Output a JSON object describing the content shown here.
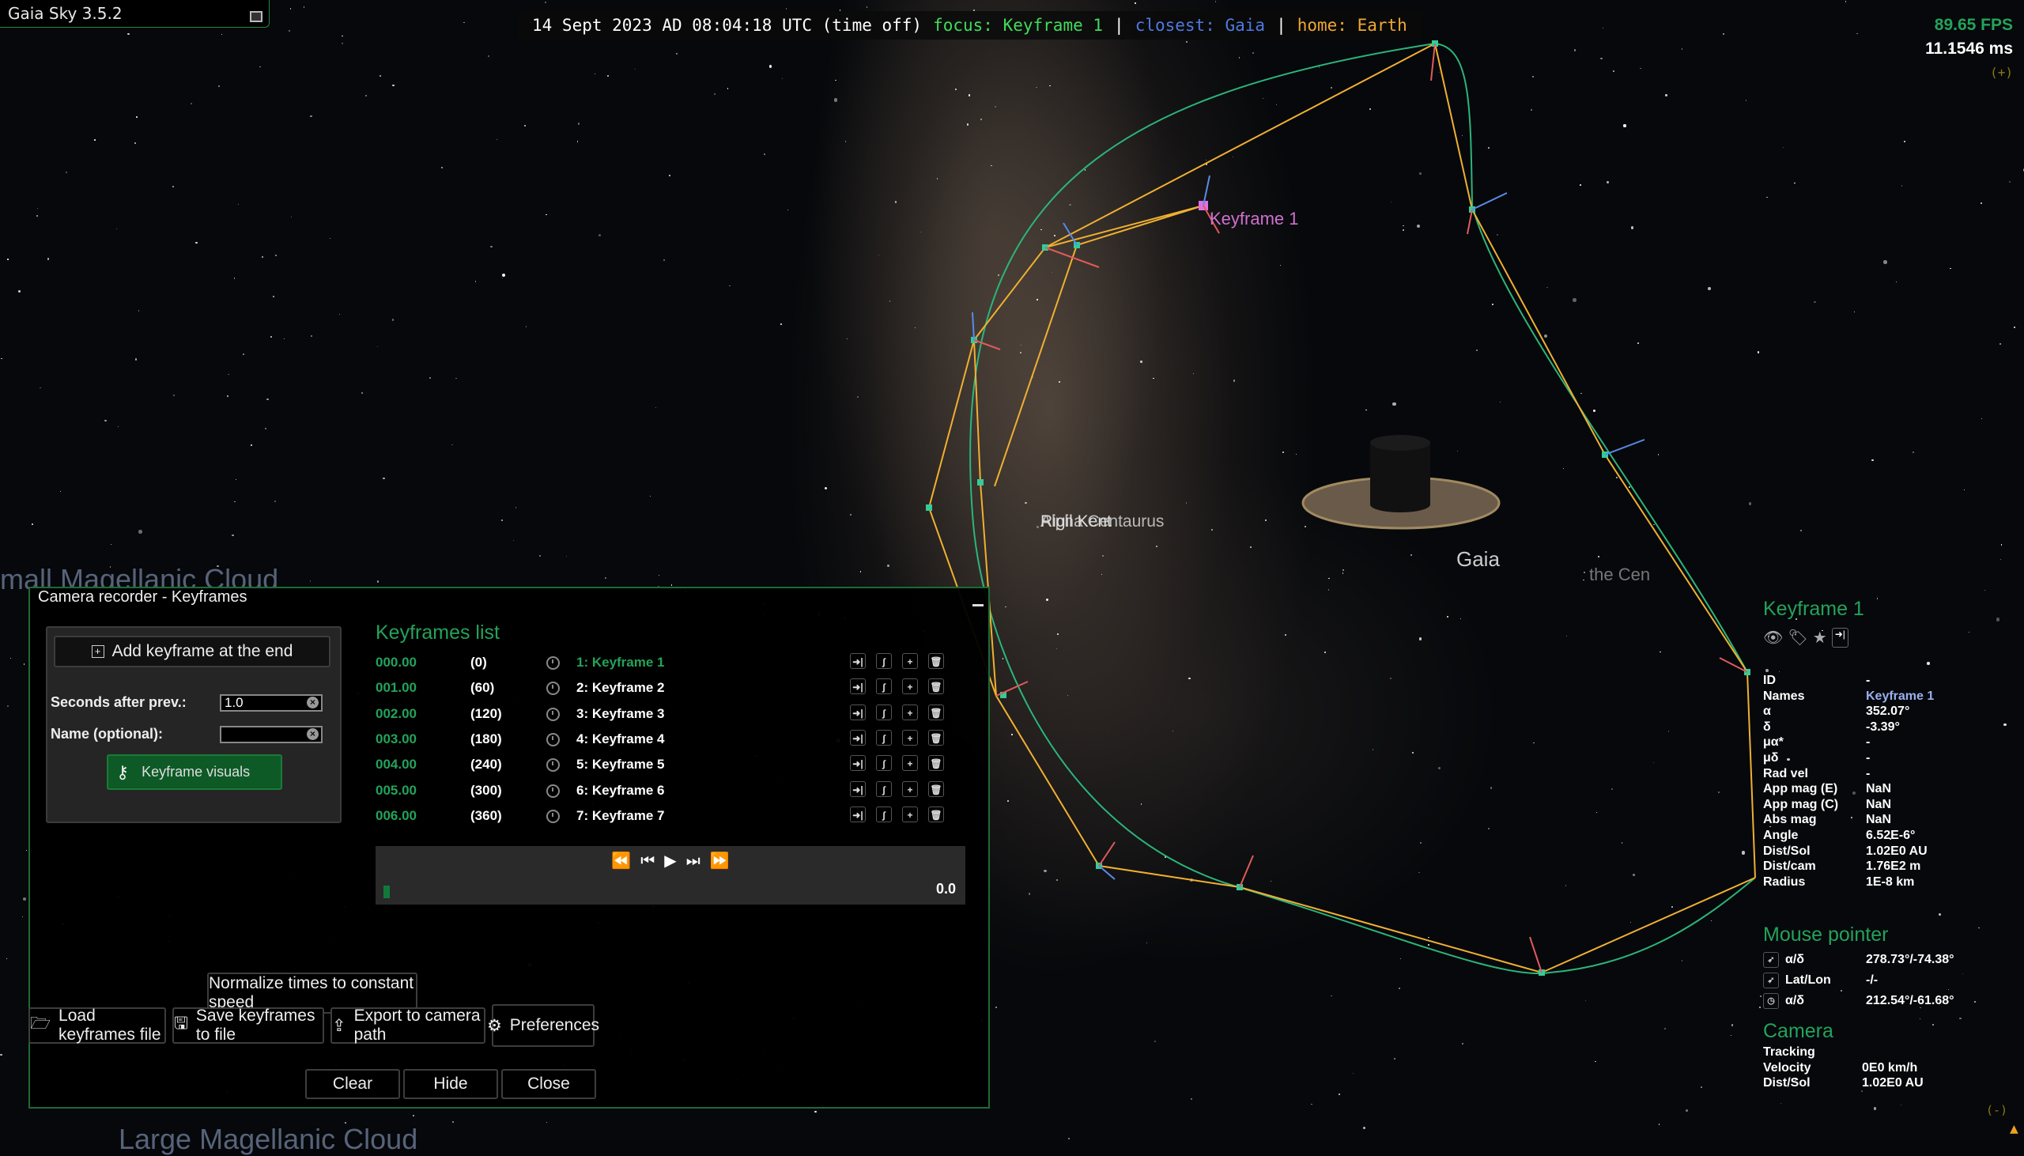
{
  "app": {
    "title": "Gaia Sky 3.5.2"
  },
  "topbar": {
    "datetime": "14 Sept 2023 AD 08:04:18 UTC (time off)",
    "focus": "focus: Keyframe 1",
    "closest": "closest: Gaia",
    "home": "home: Earth",
    "separator": "|",
    "colors": {
      "focus": "#3fdc5a",
      "closest": "#4f79e0",
      "home": "#f0a830"
    }
  },
  "perf": {
    "fps": "89.65 FPS",
    "frame_time": "11.1546 ms",
    "expand": "(+)"
  },
  "scene": {
    "labels": {
      "smc": "mall Magellanic Cloud",
      "lmc": "Large Magellanic Cloud",
      "overlap": "Rigil Kent",
      "centaurus": "Alpha Centaurus",
      "gaia": "Gaia",
      "the_cen": "the Cen",
      "keyframe": "Keyframe 1"
    }
  },
  "recorder": {
    "title": "Camera recorder - Keyframes",
    "add_button": "Add keyframe at the end",
    "seconds_label": "Seconds after prev.:",
    "seconds_value": "1.0",
    "name_label": "Name (optional):",
    "name_value": "",
    "visuals_button": "Keyframe visuals",
    "list_title": "Keyframes list",
    "keyframes": [
      {
        "time": "000.00",
        "frame": "(0)",
        "name": "1: Keyframe 1",
        "selected": true
      },
      {
        "time": "001.00",
        "frame": "(60)",
        "name": "2: Keyframe 2",
        "selected": false
      },
      {
        "time": "002.00",
        "frame": "(120)",
        "name": "3: Keyframe 3",
        "selected": false
      },
      {
        "time": "003.00",
        "frame": "(180)",
        "name": "4: Keyframe 4",
        "selected": false
      },
      {
        "time": "004.00",
        "frame": "(240)",
        "name": "5: Keyframe 5",
        "selected": false
      },
      {
        "time": "005.00",
        "frame": "(300)",
        "name": "6: Keyframe 6",
        "selected": false
      },
      {
        "time": "006.00",
        "frame": "(360)",
        "name": "7: Keyframe 7",
        "selected": false
      }
    ],
    "row_actions": [
      "go-to-keyframe",
      "seam",
      "add-after",
      "delete"
    ],
    "player": {
      "position": "0.0",
      "progress": 0.0
    },
    "normalize_button": "Normalize times to constant speed",
    "load_button": "Load keyframes file",
    "save_button": "Save keyframes to file",
    "export_button": "Export to camera path",
    "preferences_button": "Preferences",
    "clear_button": "Clear",
    "hide_button": "Hide",
    "close_button": "Close"
  },
  "focus_panel": {
    "title": "Keyframe 1",
    "rows": [
      {
        "k": "ID",
        "v": "-"
      },
      {
        "k": "Names",
        "v": "Keyframe 1",
        "blue": true
      },
      {
        "k": "α",
        "v": "352.07°"
      },
      {
        "k": "δ",
        "v": "-3.39°"
      },
      {
        "k": "μα*",
        "v": "-"
      },
      {
        "k": "μδ",
        "v": "-"
      },
      {
        "k": "Rad vel",
        "v": "-"
      },
      {
        "k": "App mag (E)",
        "v": "NaN"
      },
      {
        "k": "App mag (C)",
        "v": "NaN"
      },
      {
        "k": "Abs mag",
        "v": "NaN"
      },
      {
        "k": "Angle",
        "v": "6.52E-6°"
      },
      {
        "k": "Dist/Sol",
        "v": "1.02E0 AU"
      },
      {
        "k": "Dist/cam",
        "v": "1.76E2 m"
      },
      {
        "k": "Radius",
        "v": "1E-8 km"
      }
    ]
  },
  "mouse_panel": {
    "title": "Mouse pointer",
    "rows": [
      {
        "k": "α/δ",
        "v": "278.73°/-74.38°",
        "icon": "arrow"
      },
      {
        "k": "Lat/Lon",
        "v": "-/-",
        "icon": "arrow"
      },
      {
        "k": "α/δ",
        "v": "212.54°/-61.68°",
        "icon": "clock"
      }
    ]
  },
  "camera_panel": {
    "title": "Camera",
    "rows": [
      {
        "k": "Tracking",
        "v": ""
      },
      {
        "k": "Velocity",
        "v": "0E0 km/h"
      },
      {
        "k": "Dist/Sol",
        "v": "1.02E0 AU"
      }
    ],
    "collapse": "(-)"
  }
}
